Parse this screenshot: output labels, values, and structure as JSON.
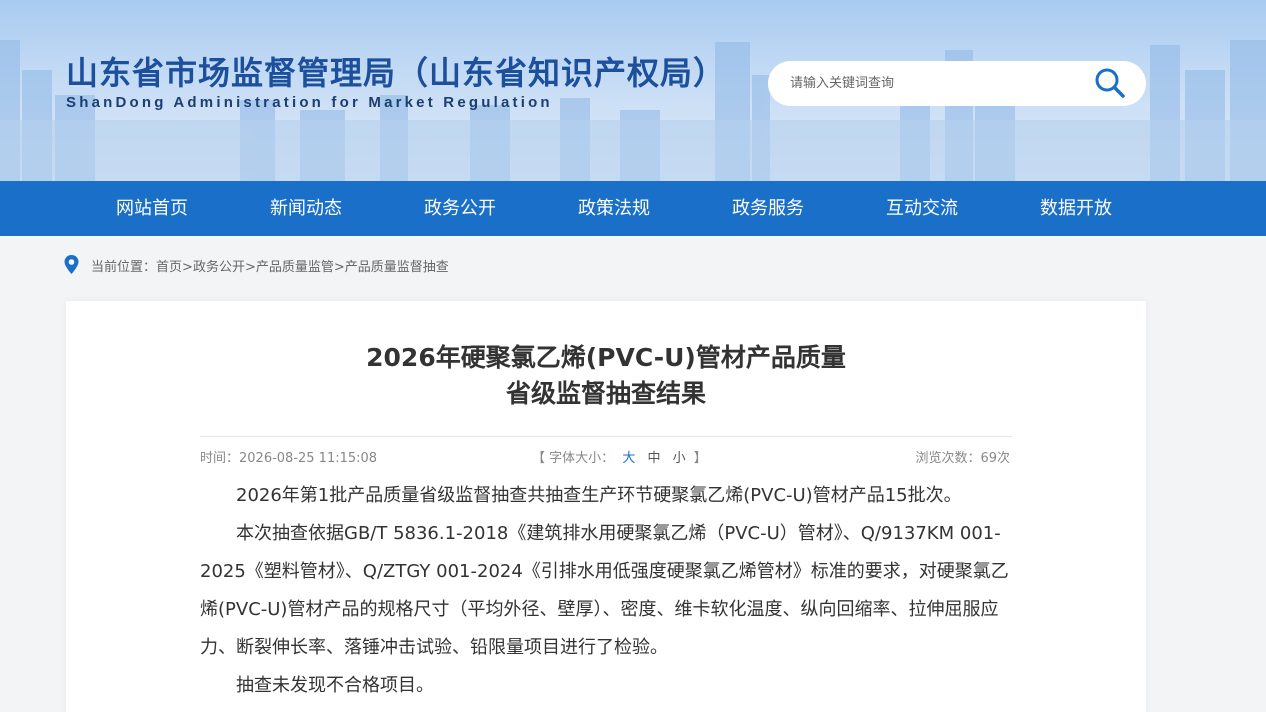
{
  "header": {
    "title": "山东省市场监督管理局（山东省知识产权局）",
    "subtitle": "ShanDong Administration for Market Regulation",
    "search": {
      "placeholder": "请输入关键词查询"
    }
  },
  "nav": {
    "items": [
      {
        "label": "网站首页"
      },
      {
        "label": "新闻动态"
      },
      {
        "label": "政务公开"
      },
      {
        "label": "政策法规"
      },
      {
        "label": "政务服务"
      },
      {
        "label": "互动交流"
      },
      {
        "label": "数据开放"
      }
    ]
  },
  "breadcrumb": {
    "prefix": "当前位置：",
    "items": [
      "首页",
      "政务公开",
      "产品质量监管",
      "产品质量监督抽查"
    ],
    "separator": ">"
  },
  "article": {
    "title_line1": "2026年硬聚氯乙烯(PVC-U)管材产品质量",
    "title_line2": "省级监督抽查结果",
    "time": "时间：2026-08-25 11:15:08",
    "font_size": {
      "open": "【",
      "label": "字体大小：",
      "large": "大",
      "medium": "中",
      "small": "小",
      "close": "】"
    },
    "views": "浏览次数：69次",
    "paragraphs": [
      "2026年第1批产品质量省级监督抽查共抽查生产环节硬聚氯乙烯(PVC-U)管材产品15批次。",
      "本次抽查依据GB/T 5836.1-2018《建筑排水用硬聚氯乙烯（PVC-U）管材》、Q/9137KM 001-2025《塑料管材》、Q/ZTGY 001-2024《引排水用低强度硬聚氯乙烯管材》标准的要求，对硬聚氯乙烯(PVC-U)管材产品的规格尺寸（平均外径、壁厚）、密度、维卡软化温度、纵向回缩率、拉伸屈服应力、断裂伸长率、落锤冲击试验、铅限量项目进行了检验。",
      "抽查未发现不合格项目。"
    ]
  },
  "colors": {
    "nav_bg": "#1a6fc9",
    "title_blue": "#1c4f9c",
    "accent": "#1a6fc9"
  },
  "icons": {
    "search": "search-icon",
    "location": "location-pin-icon"
  }
}
